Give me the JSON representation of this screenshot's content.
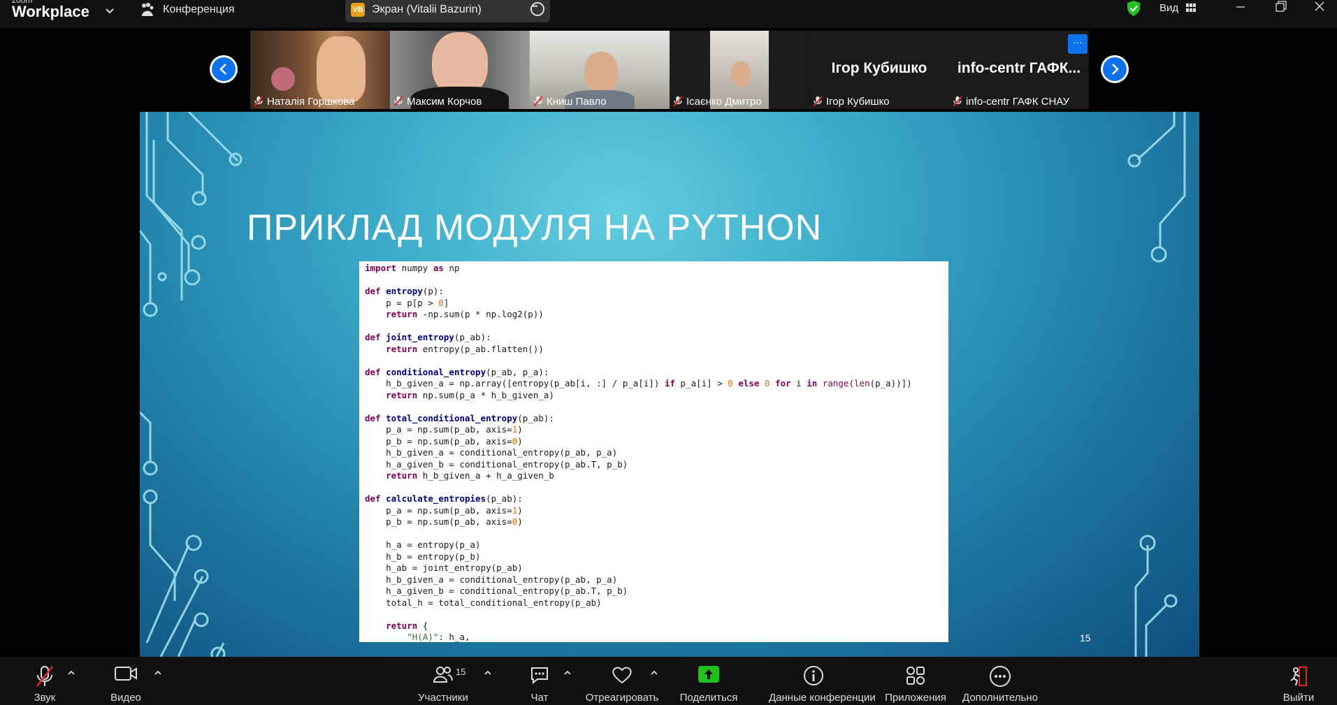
{
  "topbar": {
    "logo_line1": "zoom",
    "logo_line2": "Workplace",
    "conference_label": "Конференция",
    "share_badge": "VB",
    "share_title": "Экран (Vitalii Bazurin)",
    "view_label": "Вид"
  },
  "gallery": {
    "participants": [
      {
        "name": "Наталія Горшкова",
        "bg": "#6b4a32",
        "video": true
      },
      {
        "name": "Максим Корчов",
        "bg": "#5a5a5a",
        "video": true
      },
      {
        "name": "Книш Павло",
        "bg": "#c8c8c0",
        "video": true
      },
      {
        "name": "Ісаєнко Дмитро",
        "bg": "#1c1c1c",
        "video": true
      },
      {
        "name": "Ігор Кубишко",
        "display": "Ігор Кубишко",
        "video": false
      },
      {
        "name": "info-centr ГАФК СНАУ",
        "display": "info-centr  ГАФК...",
        "video": false
      }
    ],
    "more_label": "···"
  },
  "slide": {
    "title": "ПРИКЛАД МОДУЛЯ НА PYTHON",
    "number": "15",
    "code_lines": [
      "import numpy as np",
      "",
      "def entropy(p):",
      "    p = p[p > 0]",
      "    return -np.sum(p * np.log2(p))",
      "",
      "def joint_entropy(p_ab):",
      "    return entropy(p_ab.flatten())",
      "",
      "def conditional_entropy(p_ab, p_a):",
      "    h_b_given_a = np.array([entropy(p_ab[i, :] / p_a[i]) if p_a[i] > 0 else 0 for i in range(len(p_a))])",
      "    return np.sum(p_a * h_b_given_a)",
      "",
      "def total_conditional_entropy(p_ab):",
      "    p_a = np.sum(p_ab, axis=1)",
      "    p_b = np.sum(p_ab, axis=0)",
      "    h_b_given_a = conditional_entropy(p_ab, p_a)",
      "    h_a_given_b = conditional_entropy(p_ab.T, p_b)",
      "    return h_b_given_a + h_a_given_b",
      "",
      "def calculate_entropies(p_ab):",
      "    p_a = np.sum(p_ab, axis=1)",
      "    p_b = np.sum(p_ab, axis=0)",
      "",
      "    h_a = entropy(p_a)",
      "    h_b = entropy(p_b)",
      "    h_ab = joint_entropy(p_ab)",
      "    h_b_given_a = conditional_entropy(p_ab, p_a)",
      "    h_a_given_b = conditional_entropy(p_ab.T, p_b)",
      "    total_h = total_conditional_entropy(p_ab)",
      "",
      "    return {",
      "        \"H(A)\": h_a,"
    ]
  },
  "toolbar": {
    "audio_label": "Звук",
    "video_label": "Видео",
    "participants_label": "Участники",
    "participants_count": "15",
    "chat_label": "Чат",
    "react_label": "Отреагировать",
    "share_label": "Поделиться",
    "info_label": "Данные конференции",
    "apps_label": "Приложения",
    "more_label": "Дополнительно",
    "leave_label": "Выйти"
  },
  "colors": {
    "accent_blue": "#0e72ed",
    "share_green": "#1ec11e",
    "mute_red": "#e02828",
    "keyword": "#7f0055",
    "funcname": "#000080",
    "number": "#e07000",
    "string": "#2a7d2a"
  }
}
